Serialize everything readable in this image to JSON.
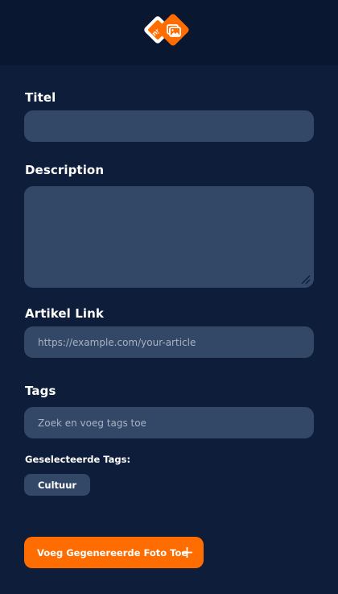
{
  "header": {
    "logo_icon": "npo-photo-logo-icon"
  },
  "form": {
    "title_label": "Titel",
    "title_value": "",
    "description_label": "Description",
    "description_value": "",
    "link_label": "Artikel Link",
    "link_placeholder": "https://example.com/your-article",
    "tags_label": "Tags",
    "tags_placeholder": "Zoek en voeg tags toe",
    "selected_tags_label": "Geselecteerde Tags:",
    "selected_tags": [
      "Cultuur"
    ],
    "add_photo_label": "Voeg Gegenereerde Foto Toe",
    "add_photo_icon": "plus-icon"
  },
  "colors": {
    "background": "#0e1d3a",
    "header": "#0a1730",
    "field": "#334766",
    "accent": "#ff6d00"
  }
}
